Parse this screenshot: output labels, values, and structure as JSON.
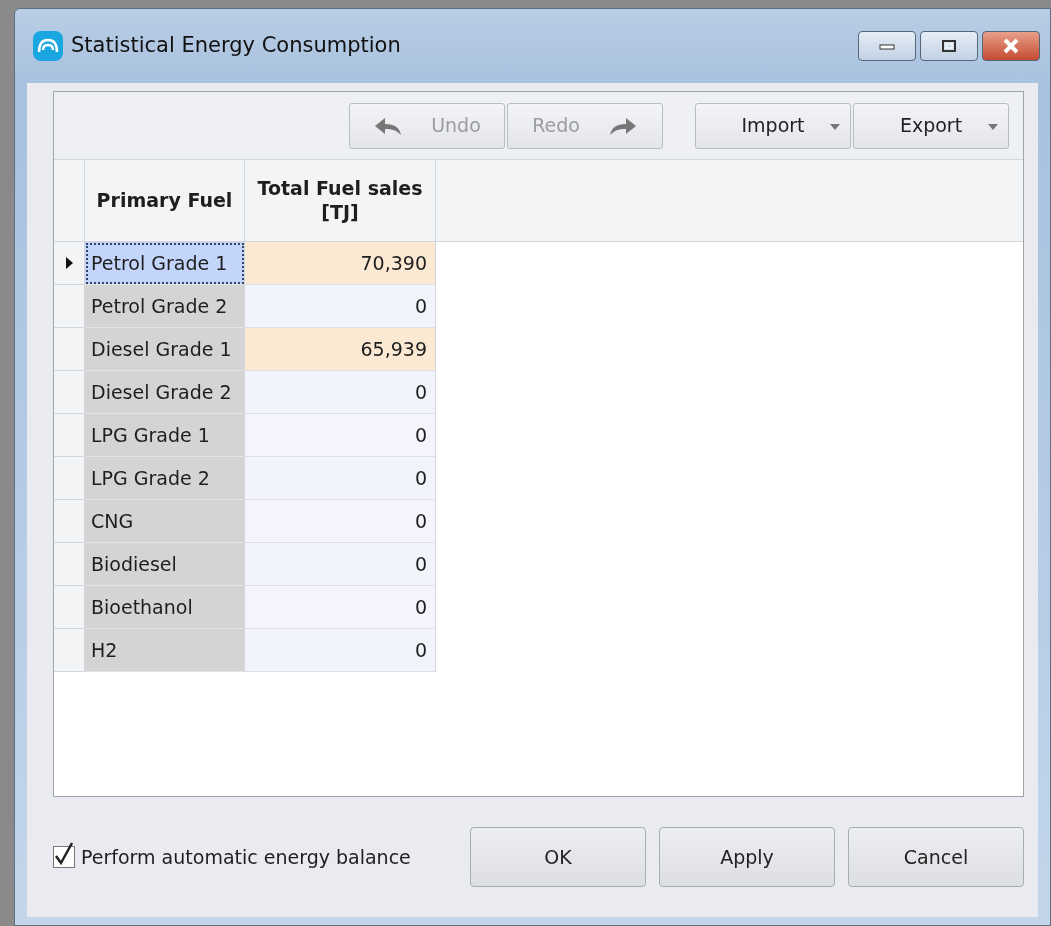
{
  "window": {
    "title": "Statistical Energy Consumption"
  },
  "toolbar": [
    {
      "label": "Undo",
      "kind": "undo",
      "disabled": true
    },
    {
      "label": "Redo",
      "kind": "redo",
      "disabled": true
    },
    {
      "label": "Import",
      "kind": "dropdown",
      "disabled": false
    },
    {
      "label": "Export",
      "kind": "dropdown",
      "disabled": false
    }
  ],
  "table": {
    "columns": [
      "Primary Fuel",
      "Total Fuel sales [TJ]"
    ],
    "rows": [
      {
        "fuel": "Petrol Grade 1",
        "sales": "70,390",
        "selected": true,
        "highlighted": true
      },
      {
        "fuel": "Petrol Grade 2",
        "sales": "0",
        "selected": false,
        "highlighted": false
      },
      {
        "fuel": "Diesel Grade 1",
        "sales": "65,939",
        "selected": false,
        "highlighted": true
      },
      {
        "fuel": "Diesel Grade 2",
        "sales": "0",
        "selected": false,
        "highlighted": false
      },
      {
        "fuel": "LPG Grade 1",
        "sales": "0",
        "selected": false,
        "highlighted": false
      },
      {
        "fuel": "LPG Grade 2",
        "sales": "0",
        "selected": false,
        "highlighted": false
      },
      {
        "fuel": "CNG",
        "sales": "0",
        "selected": false,
        "highlighted": false
      },
      {
        "fuel": "Biodiesel",
        "sales": "0",
        "selected": false,
        "highlighted": false
      },
      {
        "fuel": "Bioethanol",
        "sales": "0",
        "selected": false,
        "highlighted": false
      },
      {
        "fuel": "H2",
        "sales": "0",
        "selected": false,
        "highlighted": false
      }
    ]
  },
  "balance_checkbox": {
    "label": "Perform automatic energy balance",
    "checked": true
  },
  "buttons": [
    "OK",
    "Apply",
    "Cancel"
  ]
}
